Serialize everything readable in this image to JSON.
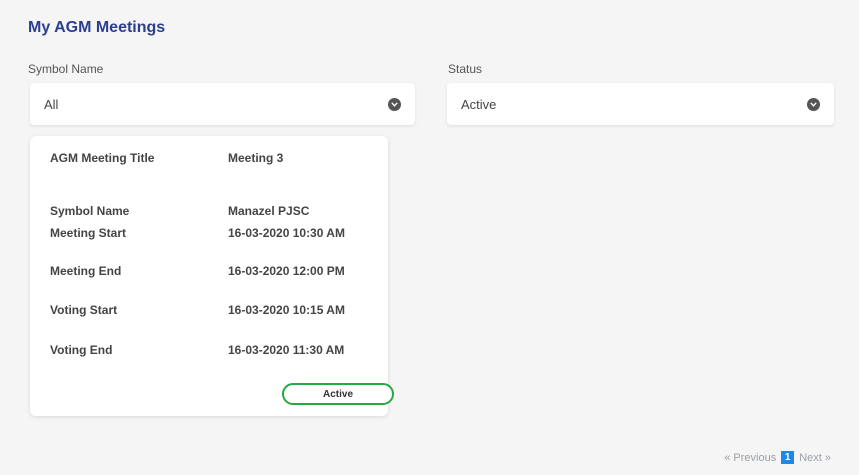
{
  "page": {
    "title": "My AGM Meetings"
  },
  "filters": {
    "symbol": {
      "label": "Symbol Name",
      "value": "All"
    },
    "status": {
      "label": "Status",
      "value": "Active"
    }
  },
  "meeting_card": {
    "title_label": "AGM Meeting Title",
    "title_value": "Meeting 3",
    "rows": [
      {
        "label": "Symbol Name",
        "value": "Manazel PJSC"
      },
      {
        "label": "Meeting Start",
        "value": "16-03-2020 10:30 AM"
      },
      {
        "label": "Meeting End",
        "value": "16-03-2020 12:00 PM"
      },
      {
        "label": "Voting Start",
        "value": "16-03-2020 10:15 AM"
      },
      {
        "label": "Voting End",
        "value": "16-03-2020 11:30 AM"
      }
    ],
    "status_label": "Active",
    "status_color": "#28a745"
  },
  "pagination": {
    "previous_label": "« Previous",
    "current_page": "1",
    "next_label": "Next »"
  },
  "icons": {
    "dropdown": "chevron-down-icon"
  }
}
